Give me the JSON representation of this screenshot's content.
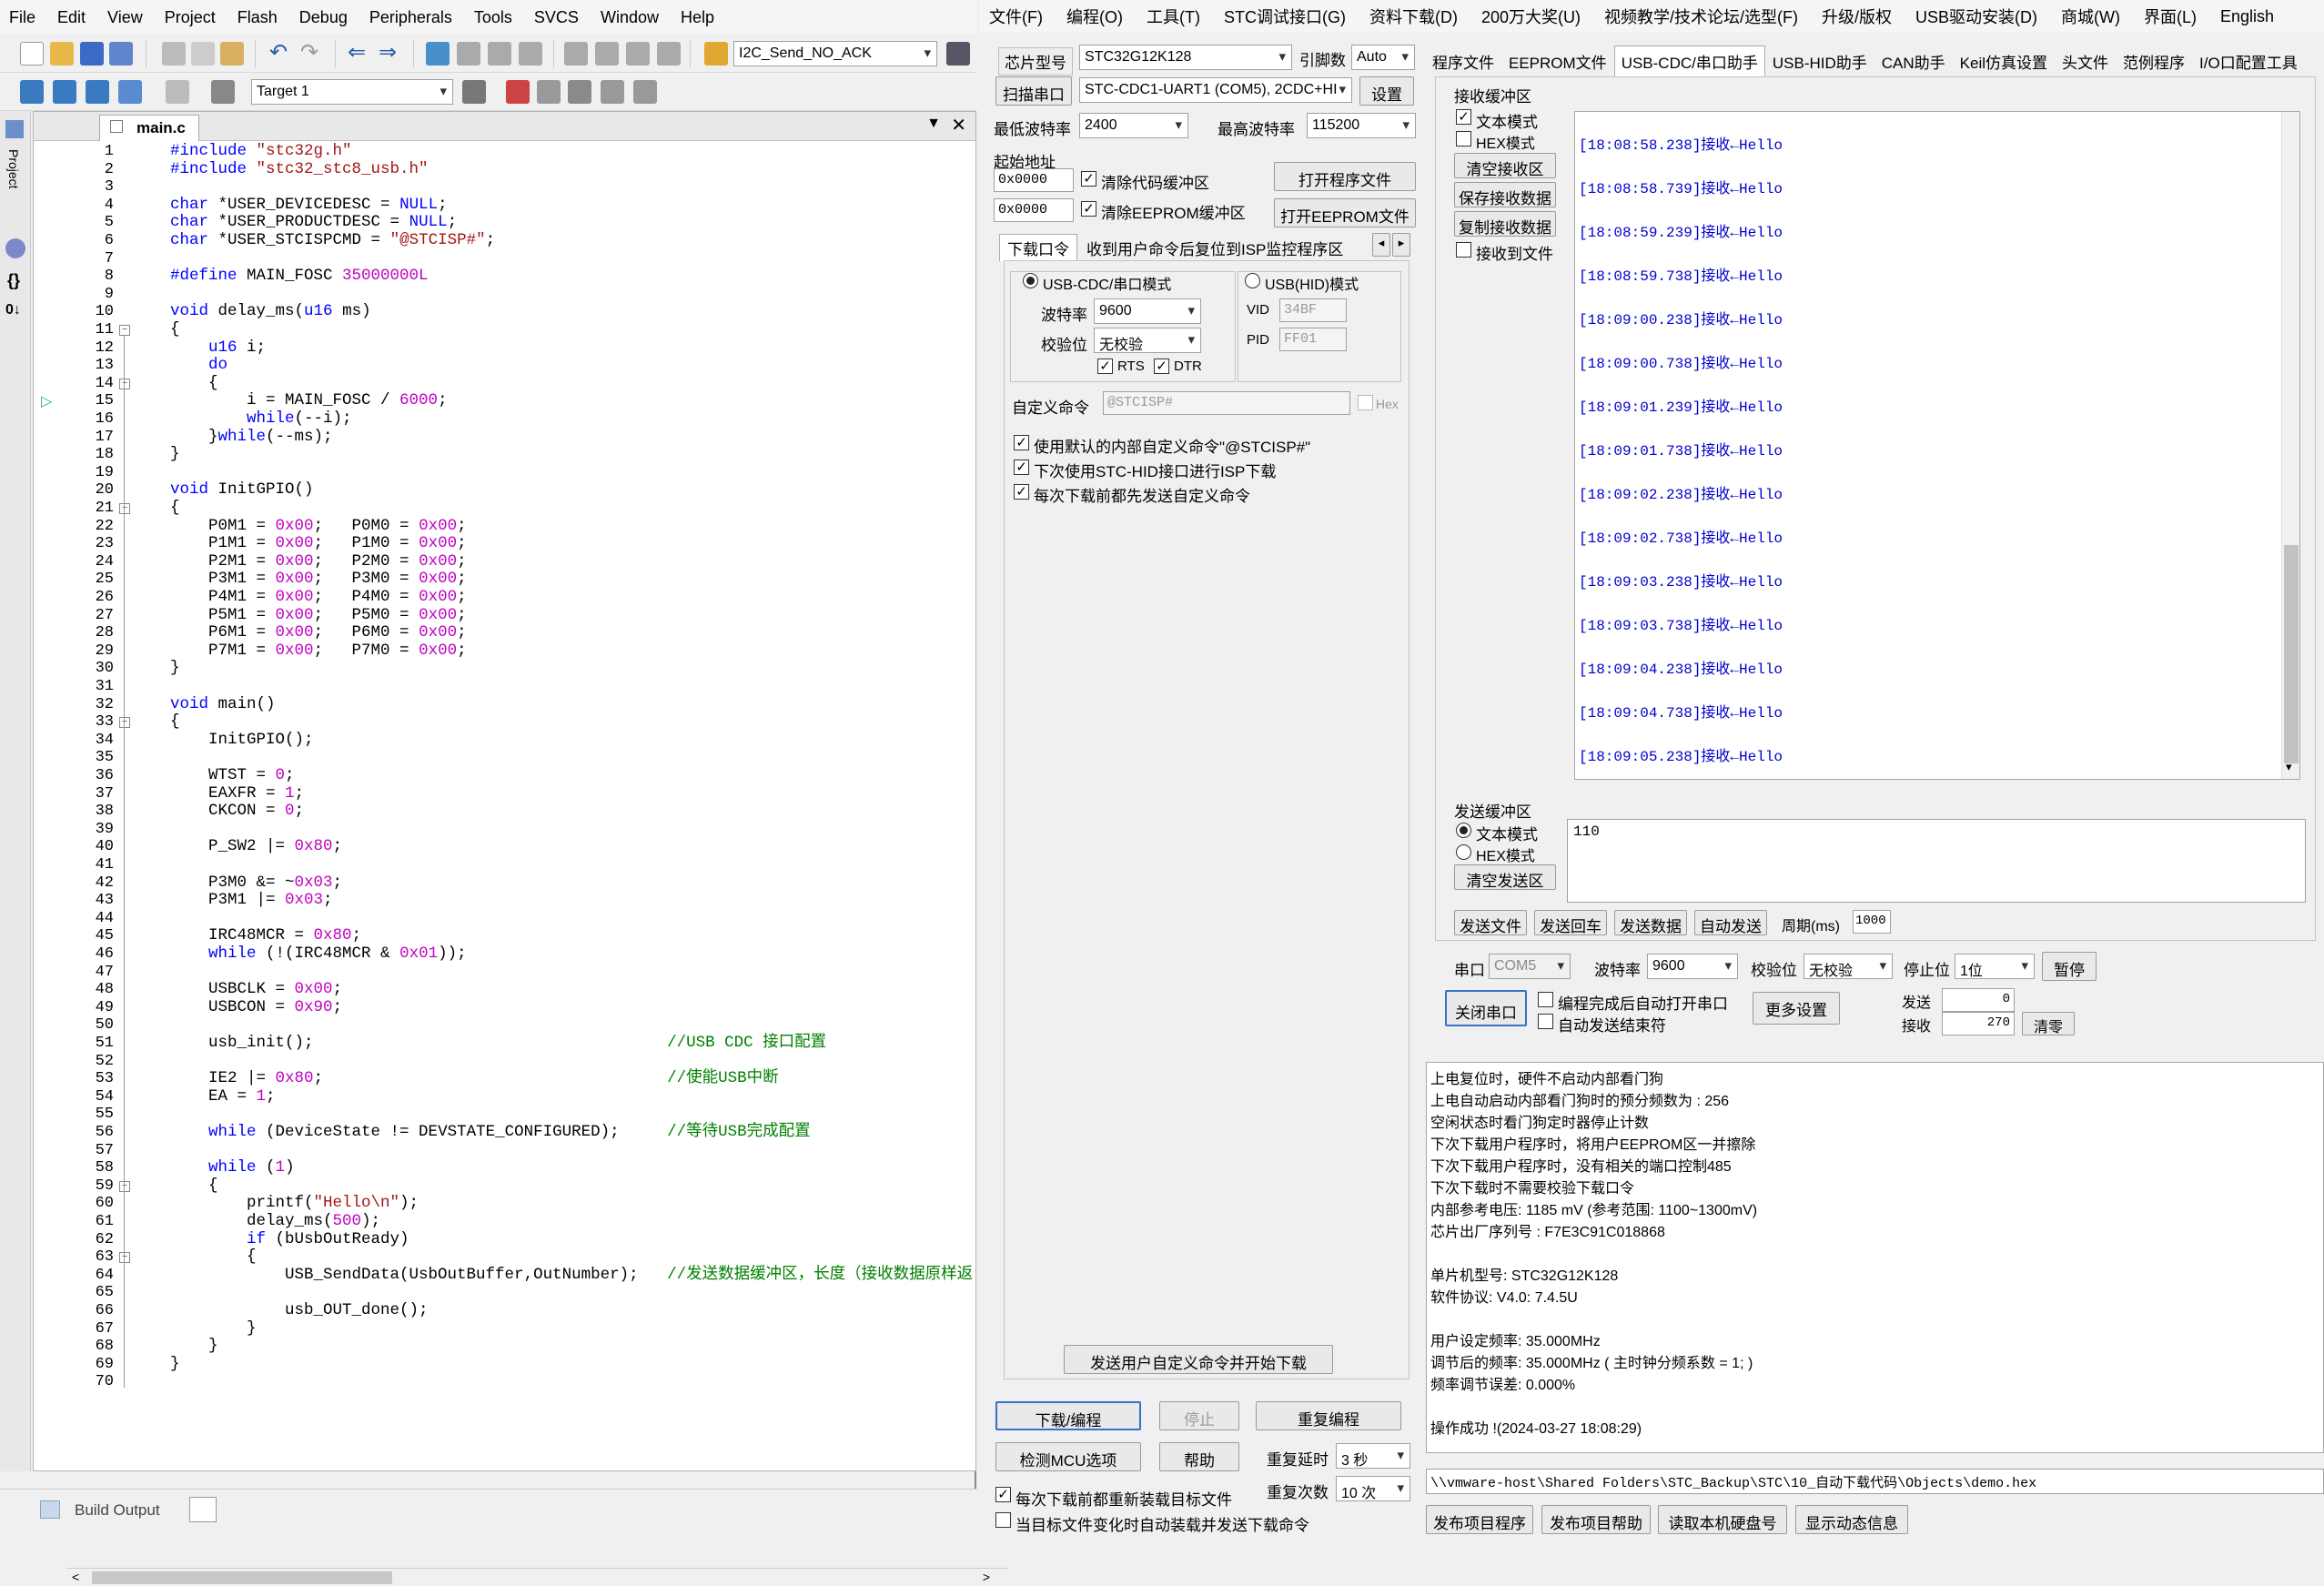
{
  "keil": {
    "menu": [
      "File",
      "Edit",
      "View",
      "Project",
      "Flash",
      "Debug",
      "Peripherals",
      "Tools",
      "SVCS",
      "Window",
      "Help"
    ],
    "toolbar_combo": "I2C_Send_NO_ACK",
    "target": "Target 1",
    "file_tab": "main.c",
    "bottom_tab": "Build Output",
    "side_label": "Project",
    "code_lines": [
      "#include \"stc32g.h\"",
      "#include \"stc32_stc8_usb.h\"",
      "",
      "char *USER_DEVICEDESC = NULL;",
      "char *USER_PRODUCTDESC = NULL;",
      "char *USER_STCISPCMD = \"@STCISP#\";",
      "",
      "#define MAIN_FOSC 35000000L",
      "",
      "void delay_ms(u16 ms)",
      "{",
      "    u16 i;",
      "    do",
      "    {",
      "        i = MAIN_FOSC / 6000;",
      "        while(--i);",
      "    }while(--ms);",
      "}",
      "",
      "void InitGPIO()",
      "{",
      "    P0M1 = 0x00;   P0M0 = 0x00;",
      "    P1M1 = 0x00;   P1M0 = 0x00;",
      "    P2M1 = 0x00;   P2M0 = 0x00;",
      "    P3M1 = 0x00;   P3M0 = 0x00;",
      "    P4M1 = 0x00;   P4M0 = 0x00;",
      "    P5M1 = 0x00;   P5M0 = 0x00;",
      "    P6M1 = 0x00;   P6M0 = 0x00;",
      "    P7M1 = 0x00;   P7M0 = 0x00;",
      "}",
      "",
      "void main()",
      "{",
      "    InitGPIO();",
      "",
      "    WTST = 0;",
      "    EAXFR = 1;",
      "    CKCON = 0;",
      "",
      "    P_SW2 |= 0x80;",
      "",
      "    P3M0 &= ~0x03;",
      "    P3M1 |= 0x03;",
      "",
      "    IRC48MCR = 0x80;",
      "    while (!(IRC48MCR & 0x01));",
      "",
      "    USBCLK = 0x00;",
      "    USBCON = 0x90;",
      "",
      "    usb_init();                                     //USB CDC 接口配置",
      "",
      "    IE2 |= 0x80;                                    //使能USB中断",
      "    EA = 1;",
      "",
      "    while (DeviceState != DEVSTATE_CONFIGURED);     //等待USB完成配置",
      "",
      "    while (1)",
      "    {",
      "        printf(\"Hello\\n\");",
      "        delay_ms(500);",
      "        if (bUsbOutReady)",
      "        {",
      "            USB_SendData(UsbOutBuffer,OutNumber);   //发送数据缓冲区，长度（接收数据原样返",
      "",
      "            usb_OUT_done();",
      "        }",
      "    }",
      "}",
      ""
    ]
  },
  "isp": {
    "menu": [
      "文件(F)",
      "编程(O)",
      "工具(T)",
      "STC调试接口(G)",
      "资料下载(D)",
      "200万大奖(U)",
      "视频教学/技术论坛/选型(F)",
      "升级/版权",
      "USB驱动安装(D)",
      "商城(W)",
      "界面(L)",
      "English"
    ],
    "chip_label": "芯片型号",
    "chip_value": "STC32G12K128",
    "pin_label": "引脚数",
    "pin_value": "Auto",
    "scan_btn": "扫描串口",
    "port_value": "STC-CDC1-UART1 (COM5), 2CDC+HI",
    "settings_btn": "设置",
    "min_baud_label": "最低波特率",
    "min_baud": "2400",
    "max_baud_label": "最高波特率",
    "max_baud": "115200",
    "start_addr_label": "起始地址",
    "addr1": "0x0000",
    "addr2": "0x0000",
    "clear_code": "清除代码缓冲区",
    "clear_eeprom": "清除EEPROM缓冲区",
    "open_prog": "打开程序文件",
    "open_eeprom": "打开EEPROM文件",
    "dl_tabs": [
      "下载口令",
      "收到用户命令后复位到ISP监控程序区"
    ],
    "mode_cdc": "USB-CDC/串口模式",
    "mode_hid": "USB(HID)模式",
    "baud_label": "波特率",
    "baud_value": "9600",
    "parity_label": "校验位",
    "parity_value": "无校验",
    "rts": "RTS",
    "dtr": "DTR",
    "vid_label": "VID",
    "vid_value": "34BF",
    "pid_label": "PID",
    "pid_value": "FF01",
    "custom_cmd_label": "自定义命令",
    "custom_cmd_value": "@STCISP#",
    "hex_label": "Hex",
    "opt1": "使用默认的内部自定义命令\"@STCISP#\"",
    "opt2": "下次使用STC-HID接口进行ISP下载",
    "opt3": "每次下载前都先发送自定义命令",
    "send_custom_btn": "发送用户自定义命令并开始下载",
    "download_btn": "下载/编程",
    "stop_btn": "停止",
    "reprog_btn": "重复编程",
    "check_mcu_btn": "检测MCU选项",
    "help_btn": "帮助",
    "repeat_delay_label": "重复延时",
    "repeat_delay": "3 秒",
    "repeat_count_label": "重复次数",
    "repeat_count": "10 次",
    "reload_each": "每次下载前都重新装载目标文件",
    "auto_load": "当目标文件变化时自动装载并发送下载命令",
    "right_tabs": [
      "程序文件",
      "EEPROM文件",
      "USB-CDC/串口助手",
      "USB-HID助手",
      "CAN助手",
      "Keil仿真设置",
      "头文件",
      "范例程序",
      "I/O口配置工具"
    ],
    "recv_group": "接收缓冲区",
    "recv_text_mode": "文本模式",
    "recv_hex_mode": "HEX模式",
    "clear_recv": "清空接收区",
    "save_recv": "保存接收数据",
    "copy_recv": "复制接收数据",
    "recv_to_file": "接收到文件",
    "recv_lines": [
      "[18:08:58.238]接收←Hello",
      "[18:08:58.739]接收←Hello",
      "[18:08:59.239]接收←Hello",
      "[18:08:59.738]接收←Hello",
      "[18:09:00.238]接收←Hello",
      "[18:09:00.738]接收←Hello",
      "[18:09:01.239]接收←Hello",
      "[18:09:01.738]接收←Hello",
      "[18:09:02.238]接收←Hello",
      "[18:09:02.738]接收←Hello",
      "[18:09:03.238]接收←Hello",
      "[18:09:03.738]接收←Hello",
      "[18:09:04.238]接收←Hello",
      "[18:09:04.738]接收←Hello",
      "[18:09:05.238]接收←Hello"
    ],
    "send_group": "发送缓冲区",
    "send_text_mode": "文本模式",
    "send_hex_mode": "HEX模式",
    "clear_send": "清空发送区",
    "send_value": "110",
    "send_file": "发送文件",
    "send_enter": "发送回车",
    "send_data": "发送数据",
    "auto_send": "自动发送",
    "period_label": "周期(ms)",
    "period_value": "1000",
    "port_label": "串口",
    "port_combo": "COM5",
    "baud2_label": "波特率",
    "baud2_value": "9600",
    "parity2_label": "校验位",
    "parity2_value": "无校验",
    "stop_label": "停止位",
    "stop_value": "1位",
    "pause_btn": "暂停",
    "close_port": "关闭串口",
    "auto_open": "编程完成后自动打开串口",
    "auto_send_end": "自动发送结束符",
    "more_settings": "更多设置",
    "sent_label": "发送",
    "sent_value": "0",
    "recv_label": "接收",
    "recv_value": "270",
    "clear_btn": "清零",
    "info_lines": [
      "  上电复位时，硬件不启动内部看门狗",
      "  上电自动启动内部看门狗时的预分频数为 : 256",
      "  空闲状态时看门狗定时器停止计数",
      "  下次下载用户程序时，将用户EEPROM区一并擦除",
      "  下次下载用户程序时，没有相关的端口控制485",
      "  下次下载时不需要校验下载口令",
      "  内部参考电压: 1185 mV (参考范围: 1100~1300mV)",
      "芯片出厂序列号 : F7E3C91C018868",
      "",
      " 单片机型号: STC32G12K128",
      " 软件协议: V4.0: 7.4.5U",
      "",
      "  用户设定频率: 35.000MHz",
      "  调节后的频率: 35.000MHz ( 主时钟分频系数 = 1; )",
      "  频率调节误差: 0.000%",
      "",
      "操作成功 !(2024-03-27 18:08:29)"
    ],
    "path_value": "\\\\vmware-host\\Shared Folders\\STC_Backup\\STC\\10_自动下载代码\\Objects\\demo.hex",
    "bottom_btns": [
      "发布项目程序",
      "发布项目帮助",
      "读取本机硬盘号",
      "显示动态信息"
    ]
  }
}
